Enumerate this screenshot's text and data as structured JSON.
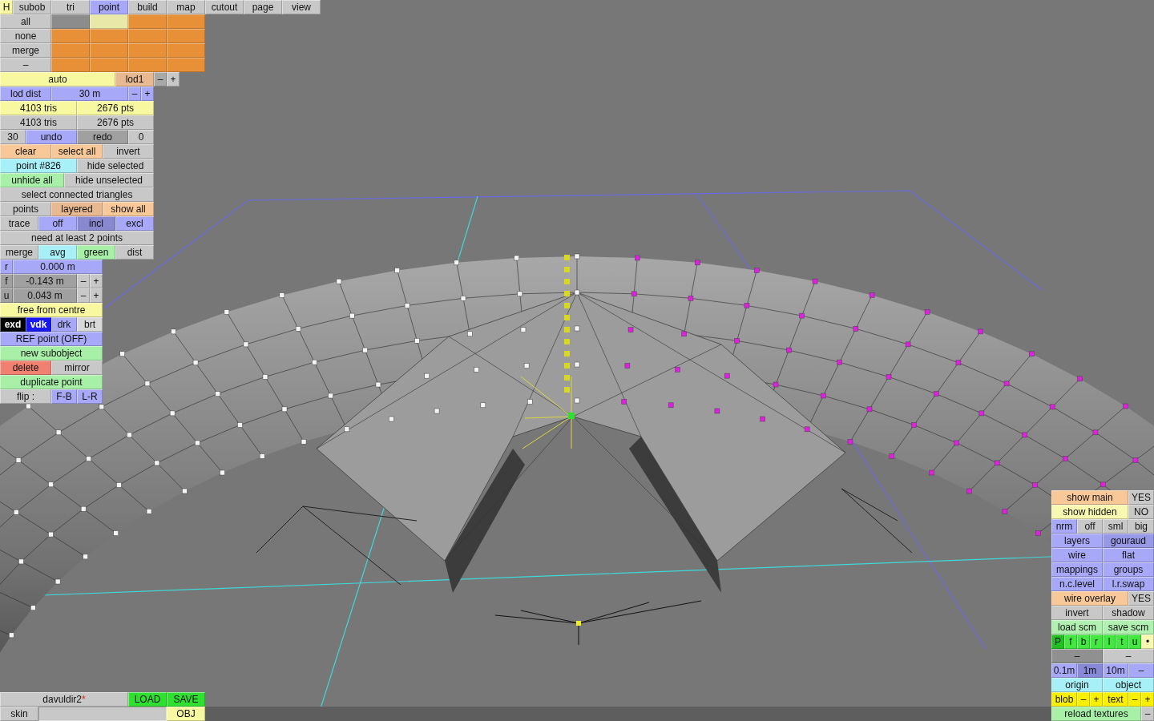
{
  "help_button": {
    "label": "H"
  },
  "tabs": [
    {
      "label": "subob",
      "selected": false
    },
    {
      "label": "tri",
      "selected": false
    },
    {
      "label": "point",
      "selected": true
    },
    {
      "label": "build",
      "selected": false
    },
    {
      "label": "map",
      "selected": false
    },
    {
      "label": "cutout",
      "selected": false
    },
    {
      "label": "page",
      "selected": false
    },
    {
      "label": "view",
      "selected": false
    }
  ],
  "left_panel": [
    [
      {
        "label": "all",
        "color": "#c8c8c8"
      },
      {
        "color": "#8c8c8c"
      },
      {
        "color": "#e8e8a8"
      },
      {
        "color": "#e89038"
      },
      {
        "color": "#e89038"
      }
    ],
    [
      {
        "label": "none",
        "color": "#c8c8c8"
      },
      {
        "color": "#e89038"
      },
      {
        "color": "#e89038"
      },
      {
        "color": "#e89038"
      },
      {
        "color": "#e89038"
      }
    ],
    [
      {
        "label": "merge",
        "color": "#c8c8c8"
      },
      {
        "color": "#e89038"
      },
      {
        "color": "#e89038"
      },
      {
        "color": "#e89038"
      },
      {
        "color": "#e89038"
      }
    ],
    [
      {
        "label": "–",
        "color": "#c8c8c8"
      },
      {
        "color": "#e89038"
      },
      {
        "color": "#e89038"
      },
      {
        "color": "#e89038"
      },
      {
        "color": "#e89038"
      }
    ],
    [
      {
        "label": "auto",
        "color": "#f8f8a0"
      },
      {
        "label": "lod1",
        "color": "#e8b890"
      },
      {
        "label": "–",
        "color": "#a8a8a8"
      },
      {
        "label": "+",
        "color": "#c8c8c8"
      }
    ],
    [
      {
        "label": "lod dist",
        "color": "#a8a8f8"
      },
      {
        "label": "30 m",
        "color": "#a8a8f8"
      },
      {
        "label": "–",
        "color": "#a8a8f8"
      },
      {
        "label": "+",
        "color": "#a8a8f8"
      }
    ],
    [
      {
        "label": "4103 tris",
        "color": "#f8f8a0"
      },
      {
        "label": "2676 pts",
        "color": "#f8f8a0"
      }
    ],
    [
      {
        "label": "4103 tris",
        "color": "#c8c8c8"
      },
      {
        "label": "2676 pts",
        "color": "#c8c8c8"
      }
    ],
    [
      {
        "label": "30",
        "color": "#c8c8c8"
      },
      {
        "label": "undo",
        "color": "#a8a8f8"
      },
      {
        "label": "redo",
        "color": "#a0a0a0"
      },
      {
        "label": "0",
        "color": "#c8c8c8"
      }
    ],
    [
      {
        "label": "clear",
        "color": "#f8c898"
      },
      {
        "label": "select all",
        "color": "#f8c898"
      },
      {
        "label": "invert",
        "color": "#c8c8c8"
      }
    ],
    [
      {
        "label": "point #826",
        "color": "#a8f0f8"
      },
      {
        "label": "hide selected",
        "color": "#c8c8c8"
      }
    ],
    [
      {
        "label": "unhide all",
        "color": "#a8f0a8"
      },
      {
        "label": "hide unselected",
        "color": "#c8c8c8"
      }
    ],
    [
      {
        "label": "select connected triangles",
        "color": "#c8c8c8"
      }
    ],
    [
      {
        "label": "points",
        "color": "#c8c8c8"
      },
      {
        "label": "layered",
        "color": "#e8b890"
      },
      {
        "label": "show all",
        "color": "#f8c898"
      }
    ],
    [
      {
        "label": "trace",
        "color": "#c8c8c8"
      },
      {
        "label": "off",
        "color": "#a8a8f8"
      },
      {
        "label": "incl",
        "color": "#8888d0"
      },
      {
        "label": "excl",
        "color": "#a8a8f8"
      }
    ],
    [
      {
        "label": "need at least 2 points",
        "color": "#c8c8c8"
      }
    ],
    [
      {
        "label": "merge",
        "color": "#c8c8c8"
      },
      {
        "label": "avg",
        "color": "#a8f0f8"
      },
      {
        "label": "green",
        "color": "#a8f0a8"
      },
      {
        "label": "dist",
        "color": "#c8c8c8"
      }
    ],
    [
      {
        "label": "r",
        "color": "#a8a8f8"
      },
      {
        "label": "0.000 m",
        "color": "#a8a8f8"
      }
    ],
    [
      {
        "label": "f",
        "color": "#a0a0a0"
      },
      {
        "label": "-0.143 m",
        "color": "#a0a0a0"
      },
      {
        "label": "–",
        "color": "#c8c8c8"
      },
      {
        "label": "+",
        "color": "#c8c8c8"
      }
    ],
    [
      {
        "label": "u",
        "color": "#a0a0a0"
      },
      {
        "label": "0.043 m",
        "color": "#a0a0a0"
      },
      {
        "label": "–",
        "color": "#c8c8c8"
      },
      {
        "label": "+",
        "color": "#c8c8c8"
      }
    ],
    [
      {
        "label": "free from centre",
        "color": "#f8f8a0"
      }
    ],
    [
      {
        "label": "exd",
        "color": "#000000"
      },
      {
        "label": "vdk",
        "color": "#1818f0"
      },
      {
        "label": "drk",
        "color": "#a8a8f8"
      },
      {
        "label": "brt",
        "color": "#d8d8d8"
      }
    ],
    [
      {
        "label": "REF point (OFF)",
        "color": "#a8a8f8"
      }
    ],
    [
      {
        "label": "new subobject",
        "color": "#a8f0a8"
      }
    ],
    [
      {
        "label": "delete",
        "color": "#f08070"
      },
      {
        "label": "mirror",
        "color": "#c8c8c8"
      }
    ],
    [
      {
        "label": "duplicate point",
        "color": "#a8f0a8"
      }
    ],
    [
      {
        "label": "flip :",
        "color": "#c8c8c8"
      },
      {
        "label": "F-B",
        "color": "#a8a8f8"
      },
      {
        "label": "L-R",
        "color": "#a8a8f8"
      }
    ]
  ],
  "file_panel": [
    [
      {
        "kind": "button",
        "label": "davuldir2",
        "marker": "*",
        "color": "#c8c8c8"
      },
      {
        "kind": "button",
        "label": "LOAD",
        "color": "#30e030"
      },
      {
        "kind": "button",
        "label": "SAVE",
        "color": "#30e030"
      }
    ],
    [
      {
        "kind": "button",
        "label": "skin",
        "color": "#c8c8c8"
      },
      {
        "kind": "field",
        "color": "#c8c8c8"
      },
      {
        "kind": "button",
        "label": "OBJ",
        "color": "#f8f8a0"
      }
    ]
  ],
  "view_panels": [
    [
      [
        {
          "label": "show main",
          "color": "#f8c898"
        },
        {
          "label": "YES",
          "color": "#c8c8c8"
        }
      ],
      [
        {
          "label": "show hidden",
          "color": "#f8f8b0"
        },
        {
          "label": "NO",
          "color": "#c8c8c8"
        }
      ],
      [
        {
          "label": "nrm",
          "color": "#a8a8f8"
        },
        {
          "label": "off",
          "color": "#c8c8c8"
        },
        {
          "label": "sml",
          "color": "#c8c8c8"
        },
        {
          "label": "big",
          "color": "#c8c8c8"
        }
      ]
    ],
    [
      [
        {
          "label": "layers",
          "color": "#a8a8f8"
        },
        {
          "label": "gouraud",
          "color": "#9898e8"
        }
      ],
      [
        {
          "label": "wire",
          "color": "#a8a8f8"
        },
        {
          "label": "flat",
          "color": "#a8a8f8"
        }
      ],
      [
        {
          "label": "mappings",
          "color": "#a8a8f8"
        },
        {
          "label": "groups",
          "color": "#a8a8f8"
        }
      ],
      [
        {
          "label": "n.c.level",
          "color": "#a8a8f8"
        },
        {
          "label": "l.r.swap",
          "color": "#a8a8f8"
        }
      ],
      [
        {
          "label": "wire overlay",
          "color": "#f8c898"
        },
        {
          "label": "YES",
          "color": "#c8c8c8"
        }
      ]
    ],
    [
      [
        {
          "label": "invert",
          "color": "#c8c8c8"
        },
        {
          "label": "shadow",
          "color": "#c8c8c8"
        }
      ],
      [
        {
          "label": "load scm",
          "color": "#b0f0b0"
        },
        {
          "label": "save scm",
          "color": "#b0f0b0"
        }
      ],
      [
        {
          "label": "P",
          "color": "#20c020"
        },
        {
          "label": "f",
          "color": "#40e840"
        },
        {
          "label": "b",
          "color": "#40e840"
        },
        {
          "label": "r",
          "color": "#40e840"
        },
        {
          "label": "l",
          "color": "#40e840"
        },
        {
          "label": "t",
          "color": "#40e840"
        },
        {
          "label": "u",
          "color": "#40e840"
        },
        {
          "label": "•",
          "color": "#f8f8b0"
        }
      ],
      [
        {
          "label": "–",
          "color": "#909090"
        },
        {
          "label": "–",
          "color": "#c8c8c8"
        }
      ],
      [
        {
          "label": "0.1m",
          "color": "#a8a8f8"
        },
        {
          "label": "1m",
          "color": "#8888d8"
        },
        {
          "label": "10m",
          "color": "#a8a8f8"
        },
        {
          "label": "–",
          "color": "#a8a8f8"
        }
      ],
      [
        {
          "label": "origin",
          "color": "#a8f0f8"
        },
        {
          "label": "object",
          "color": "#a8f0f8"
        }
      ],
      [
        {
          "label": "blob",
          "color": "#f8f000"
        },
        {
          "label": "–",
          "color": "#f8f000"
        },
        {
          "label": "+",
          "color": "#f8f000"
        },
        {
          "label": "text",
          "color": "#f8f000"
        },
        {
          "label": "–",
          "color": "#f8f000"
        },
        {
          "label": "+",
          "color": "#f8f000"
        }
      ],
      [
        {
          "label": "reload textures",
          "color": "#a8f0a8"
        },
        {
          "label": "–",
          "color": "#c8c8c8"
        }
      ]
    ]
  ]
}
